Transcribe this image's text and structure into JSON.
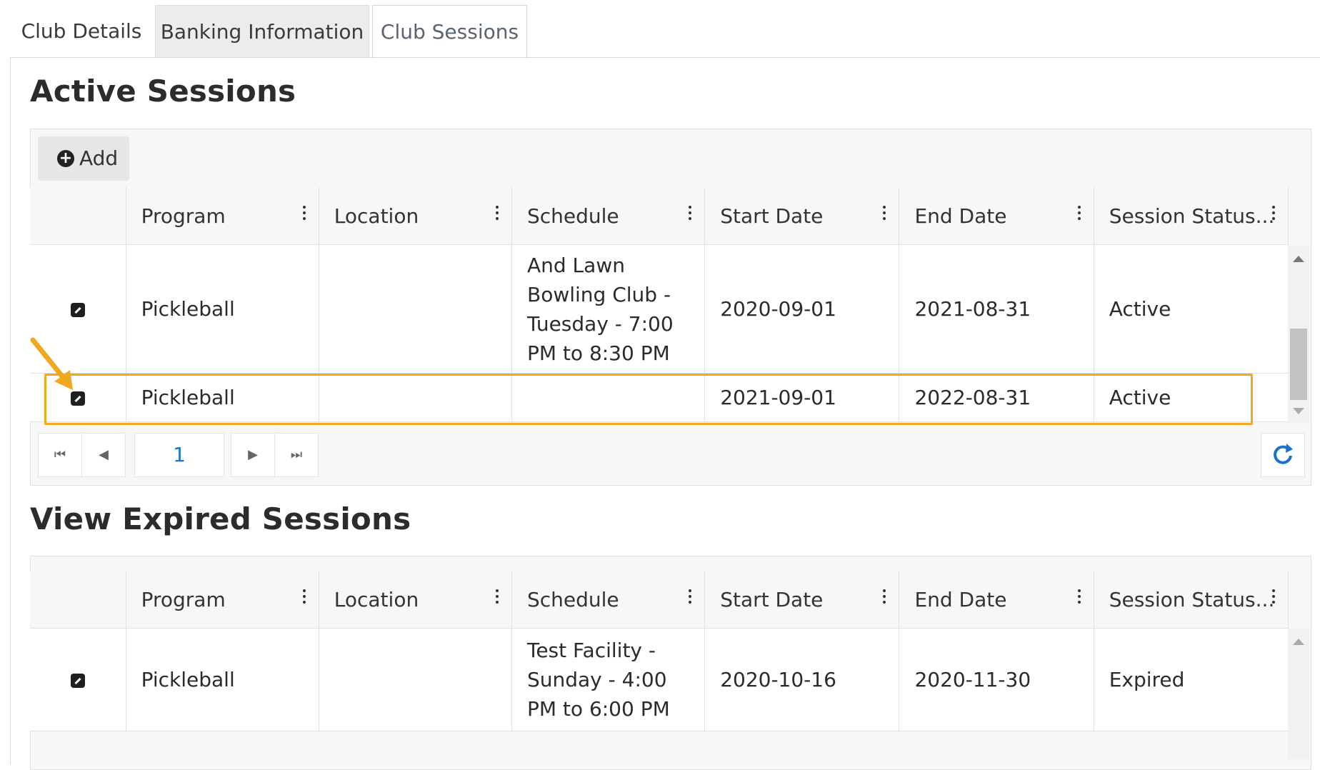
{
  "tabs": [
    {
      "label": "Club Details"
    },
    {
      "label": "Banking Information"
    },
    {
      "label": "Club Sessions"
    }
  ],
  "active_section": {
    "title": "Active Sessions",
    "add_label": "Add",
    "columns": [
      "Program",
      "Location",
      "Schedule",
      "Start Date",
      "End Date",
      "Session Status..."
    ],
    "rows": [
      {
        "program": "Pickleball",
        "location": "",
        "schedule": "And Lawn Bowling Club - Tuesday - 7:00 PM to 8:30 PM",
        "start": "2020-09-01",
        "end": "2021-08-31",
        "status": "Active"
      },
      {
        "program": "Pickleball",
        "location": "",
        "schedule": "",
        "start": "2021-09-01",
        "end": "2022-08-31",
        "status": "Active"
      }
    ],
    "pager": {
      "page": "1"
    }
  },
  "expired_section": {
    "title": "View Expired Sessions",
    "columns": [
      "Program",
      "Location",
      "Schedule",
      "Start Date",
      "End Date",
      "Session Status..."
    ],
    "rows": [
      {
        "program": "Pickleball",
        "location": "",
        "schedule": "Test Facility - Sunday - 4:00 PM to 6:00 PM",
        "start": "2020-10-16",
        "end": "2020-11-30",
        "status": "Expired"
      }
    ]
  },
  "colors": {
    "highlight": "#f0a81e",
    "accent": "#1a73c8"
  },
  "icons": [
    "plus-circle-icon",
    "edit-icon",
    "menu-dots-icon",
    "first-page-icon",
    "prev-page-icon",
    "next-page-icon",
    "last-page-icon",
    "refresh-icon",
    "scroll-up-icon",
    "scroll-down-icon",
    "annotation-arrow-icon"
  ]
}
